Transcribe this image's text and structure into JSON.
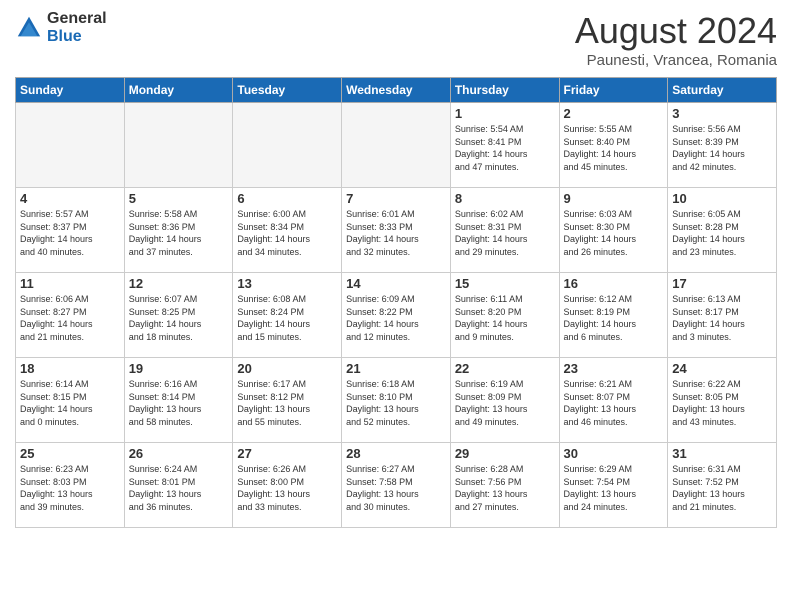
{
  "logo": {
    "line1": "General",
    "line2": "Blue"
  },
  "title": "August 2024",
  "location": "Paunesti, Vrancea, Romania",
  "days_of_week": [
    "Sunday",
    "Monday",
    "Tuesday",
    "Wednesday",
    "Thursday",
    "Friday",
    "Saturday"
  ],
  "weeks": [
    [
      {
        "day": "",
        "info": ""
      },
      {
        "day": "",
        "info": ""
      },
      {
        "day": "",
        "info": ""
      },
      {
        "day": "",
        "info": ""
      },
      {
        "day": "1",
        "info": "Sunrise: 5:54 AM\nSunset: 8:41 PM\nDaylight: 14 hours\nand 47 minutes."
      },
      {
        "day": "2",
        "info": "Sunrise: 5:55 AM\nSunset: 8:40 PM\nDaylight: 14 hours\nand 45 minutes."
      },
      {
        "day": "3",
        "info": "Sunrise: 5:56 AM\nSunset: 8:39 PM\nDaylight: 14 hours\nand 42 minutes."
      }
    ],
    [
      {
        "day": "4",
        "info": "Sunrise: 5:57 AM\nSunset: 8:37 PM\nDaylight: 14 hours\nand 40 minutes."
      },
      {
        "day": "5",
        "info": "Sunrise: 5:58 AM\nSunset: 8:36 PM\nDaylight: 14 hours\nand 37 minutes."
      },
      {
        "day": "6",
        "info": "Sunrise: 6:00 AM\nSunset: 8:34 PM\nDaylight: 14 hours\nand 34 minutes."
      },
      {
        "day": "7",
        "info": "Sunrise: 6:01 AM\nSunset: 8:33 PM\nDaylight: 14 hours\nand 32 minutes."
      },
      {
        "day": "8",
        "info": "Sunrise: 6:02 AM\nSunset: 8:31 PM\nDaylight: 14 hours\nand 29 minutes."
      },
      {
        "day": "9",
        "info": "Sunrise: 6:03 AM\nSunset: 8:30 PM\nDaylight: 14 hours\nand 26 minutes."
      },
      {
        "day": "10",
        "info": "Sunrise: 6:05 AM\nSunset: 8:28 PM\nDaylight: 14 hours\nand 23 minutes."
      }
    ],
    [
      {
        "day": "11",
        "info": "Sunrise: 6:06 AM\nSunset: 8:27 PM\nDaylight: 14 hours\nand 21 minutes."
      },
      {
        "day": "12",
        "info": "Sunrise: 6:07 AM\nSunset: 8:25 PM\nDaylight: 14 hours\nand 18 minutes."
      },
      {
        "day": "13",
        "info": "Sunrise: 6:08 AM\nSunset: 8:24 PM\nDaylight: 14 hours\nand 15 minutes."
      },
      {
        "day": "14",
        "info": "Sunrise: 6:09 AM\nSunset: 8:22 PM\nDaylight: 14 hours\nand 12 minutes."
      },
      {
        "day": "15",
        "info": "Sunrise: 6:11 AM\nSunset: 8:20 PM\nDaylight: 14 hours\nand 9 minutes."
      },
      {
        "day": "16",
        "info": "Sunrise: 6:12 AM\nSunset: 8:19 PM\nDaylight: 14 hours\nand 6 minutes."
      },
      {
        "day": "17",
        "info": "Sunrise: 6:13 AM\nSunset: 8:17 PM\nDaylight: 14 hours\nand 3 minutes."
      }
    ],
    [
      {
        "day": "18",
        "info": "Sunrise: 6:14 AM\nSunset: 8:15 PM\nDaylight: 14 hours\nand 0 minutes."
      },
      {
        "day": "19",
        "info": "Sunrise: 6:16 AM\nSunset: 8:14 PM\nDaylight: 13 hours\nand 58 minutes."
      },
      {
        "day": "20",
        "info": "Sunrise: 6:17 AM\nSunset: 8:12 PM\nDaylight: 13 hours\nand 55 minutes."
      },
      {
        "day": "21",
        "info": "Sunrise: 6:18 AM\nSunset: 8:10 PM\nDaylight: 13 hours\nand 52 minutes."
      },
      {
        "day": "22",
        "info": "Sunrise: 6:19 AM\nSunset: 8:09 PM\nDaylight: 13 hours\nand 49 minutes."
      },
      {
        "day": "23",
        "info": "Sunrise: 6:21 AM\nSunset: 8:07 PM\nDaylight: 13 hours\nand 46 minutes."
      },
      {
        "day": "24",
        "info": "Sunrise: 6:22 AM\nSunset: 8:05 PM\nDaylight: 13 hours\nand 43 minutes."
      }
    ],
    [
      {
        "day": "25",
        "info": "Sunrise: 6:23 AM\nSunset: 8:03 PM\nDaylight: 13 hours\nand 39 minutes."
      },
      {
        "day": "26",
        "info": "Sunrise: 6:24 AM\nSunset: 8:01 PM\nDaylight: 13 hours\nand 36 minutes."
      },
      {
        "day": "27",
        "info": "Sunrise: 6:26 AM\nSunset: 8:00 PM\nDaylight: 13 hours\nand 33 minutes."
      },
      {
        "day": "28",
        "info": "Sunrise: 6:27 AM\nSunset: 7:58 PM\nDaylight: 13 hours\nand 30 minutes."
      },
      {
        "day": "29",
        "info": "Sunrise: 6:28 AM\nSunset: 7:56 PM\nDaylight: 13 hours\nand 27 minutes."
      },
      {
        "day": "30",
        "info": "Sunrise: 6:29 AM\nSunset: 7:54 PM\nDaylight: 13 hours\nand 24 minutes."
      },
      {
        "day": "31",
        "info": "Sunrise: 6:31 AM\nSunset: 7:52 PM\nDaylight: 13 hours\nand 21 minutes."
      }
    ]
  ]
}
